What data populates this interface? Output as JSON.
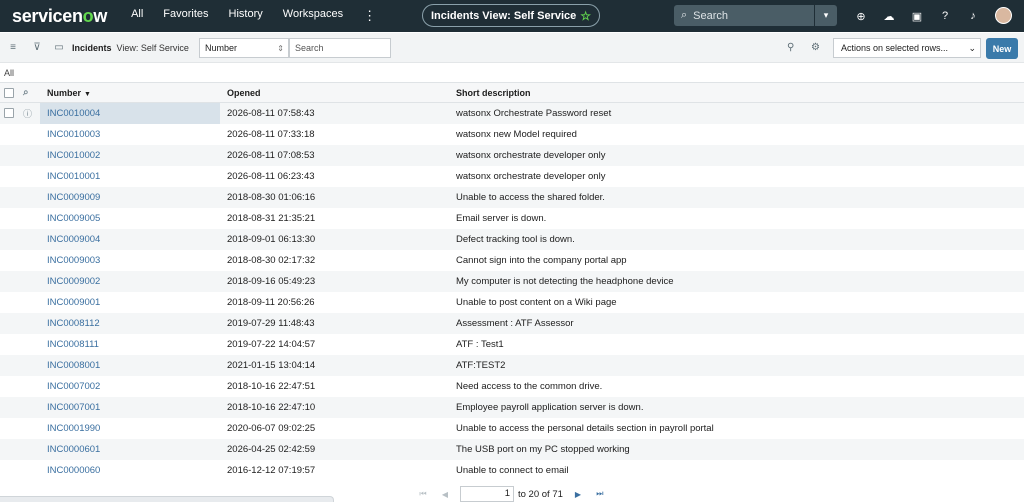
{
  "topnav": {
    "logo_main": "servicen",
    "logo_o": "o",
    "logo_end": "w",
    "links": [
      "All",
      "Favorites",
      "History",
      "Workspaces"
    ],
    "more": "⋮",
    "view_title": "Incidents View: Self Service",
    "star": "☆",
    "search_placeholder": "Search",
    "search_icon": "⌕",
    "dropdown_icon": "▾",
    "icons": [
      "globe-icon",
      "chat-icon",
      "inbox-icon",
      "help-icon",
      "bell-icon"
    ],
    "icon_glyphs": [
      "⊕",
      "☁",
      "▣",
      "?",
      "♪"
    ]
  },
  "toolbar": {
    "menu_glyph": "≡",
    "filter_glyph": "⊽",
    "chat_glyph": "▭",
    "title": "Incidents",
    "view": "View: Self Service",
    "select_value": "Number",
    "select_caret": "⇕",
    "search_placeholder": "Search",
    "pin_glyph": "⚲",
    "gear_glyph": "⚙",
    "actions_label": "Actions on selected rows...",
    "actions_caret": "⌄",
    "new_label": "New",
    "accent": "#3a7aaa"
  },
  "breadcrumb": "All",
  "table": {
    "search_glyph": "⌕",
    "sort_glyph": "▼",
    "info_glyph": "ⓘ",
    "columns": [
      "Number",
      "Opened",
      "Short description"
    ],
    "rows": [
      {
        "number": "INC0010004",
        "opened": "2026-08-11 07:58:43",
        "desc": "watsonx Orchestrate Password reset"
      },
      {
        "number": "INC0010003",
        "opened": "2026-08-11 07:33:18",
        "desc": "watsonx new Model required"
      },
      {
        "number": "INC0010002",
        "opened": "2026-08-11 07:08:53",
        "desc": "watsonx orchestrate developer only"
      },
      {
        "number": "INC0010001",
        "opened": "2026-08-11 06:23:43",
        "desc": "watsonx orchestrate developer only"
      },
      {
        "number": "INC0009009",
        "opened": "2018-08-30 01:06:16",
        "desc": "Unable to access the shared folder."
      },
      {
        "number": "INC0009005",
        "opened": "2018-08-31 21:35:21",
        "desc": "Email server is down."
      },
      {
        "number": "INC0009004",
        "opened": "2018-09-01 06:13:30",
        "desc": "Defect tracking tool is down."
      },
      {
        "number": "INC0009003",
        "opened": "2018-08-30 02:17:32",
        "desc": "Cannot sign into the company portal app"
      },
      {
        "number": "INC0009002",
        "opened": "2018-09-16 05:49:23",
        "desc": "My computer is not detecting the headphone device"
      },
      {
        "number": "INC0009001",
        "opened": "2018-09-11 20:56:26",
        "desc": "Unable to post content on a Wiki page"
      },
      {
        "number": "INC0008112",
        "opened": "2019-07-29 11:48:43",
        "desc": "Assessment : ATF Assessor"
      },
      {
        "number": "INC0008111",
        "opened": "2019-07-22 14:04:57",
        "desc": "ATF : Test1"
      },
      {
        "number": "INC0008001",
        "opened": "2021-01-15 13:04:14",
        "desc": "ATF:TEST2"
      },
      {
        "number": "INC0007002",
        "opened": "2018-10-16 22:47:51",
        "desc": "Need access to the common drive."
      },
      {
        "number": "INC0007001",
        "opened": "2018-10-16 22:47:10",
        "desc": "Employee payroll application server is down."
      },
      {
        "number": "INC0001990",
        "opened": "2020-06-07 09:02:25",
        "desc": "Unable to access the personal details section in payroll portal"
      },
      {
        "number": "INC0000601",
        "opened": "2026-04-25 02:42:59",
        "desc": "The USB port on my PC stopped working"
      },
      {
        "number": "INC0000060",
        "opened": "2016-12-12 07:19:57",
        "desc": "Unable to connect to email"
      }
    ]
  },
  "pager": {
    "first_glyph": "⏮",
    "prev_glyph": "◀",
    "next_glyph": "▶",
    "last_glyph": "⏭",
    "current": "1",
    "range_text": "to 20 of 71"
  }
}
